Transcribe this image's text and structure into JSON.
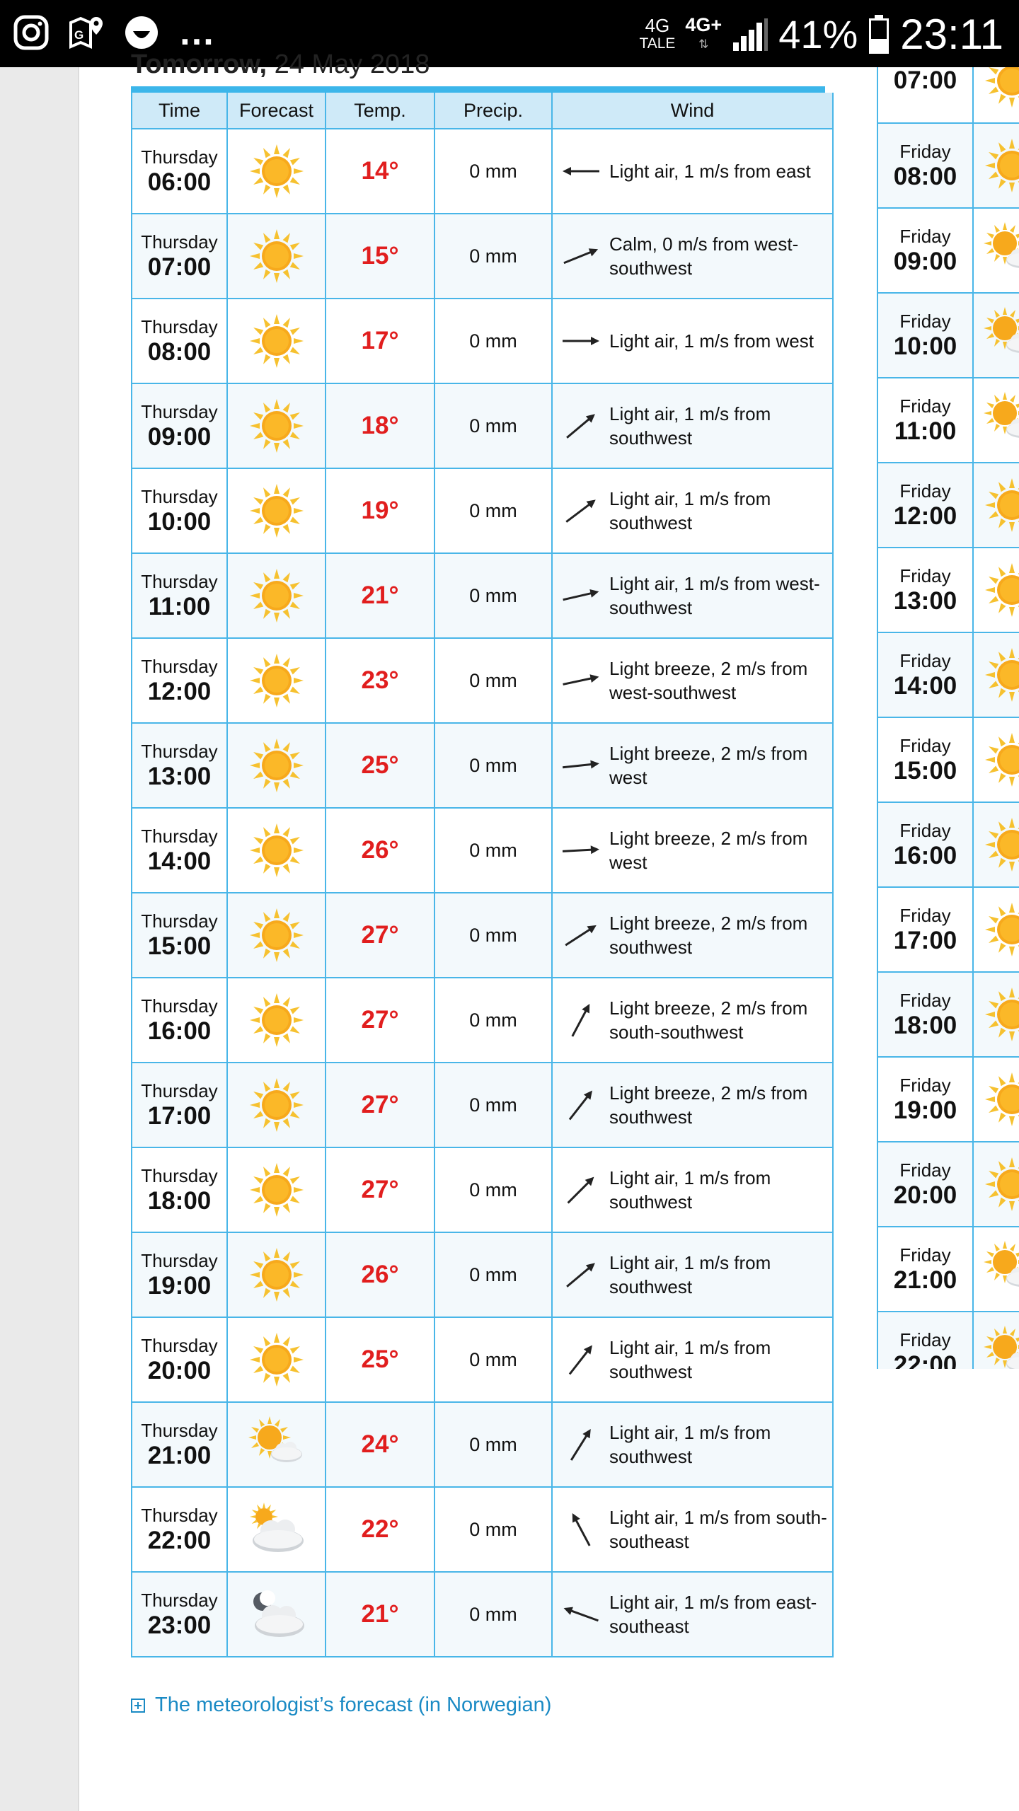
{
  "status_bar": {
    "network_1": "4G",
    "network_1_sub": "TALE",
    "network_2": "4G+",
    "battery": "41%",
    "time": "23:11"
  },
  "heading": {
    "bold": "Tomorrow,",
    "date": "24 May 2018"
  },
  "columns": {
    "time": "Time",
    "forecast": "Forecast",
    "temp": "Temp.",
    "precip": "Precip.",
    "wind": "Wind"
  },
  "rows": [
    {
      "day": "Thursday",
      "hour": "06:00",
      "icon": "sun-icon",
      "temp": "14°",
      "precip": "0 mm",
      "wind_deg": 180,
      "wind": "Light air, 1 m/s from east"
    },
    {
      "day": "Thursday",
      "hour": "07:00",
      "icon": "sun-icon",
      "temp": "15°",
      "precip": "0 mm",
      "wind_deg": -22,
      "wind": "Calm, 0 m/s from west-southwest"
    },
    {
      "day": "Thursday",
      "hour": "08:00",
      "icon": "sun-icon",
      "temp": "17°",
      "precip": "0 mm",
      "wind_deg": 0,
      "wind": "Light air, 1 m/s from west"
    },
    {
      "day": "Thursday",
      "hour": "09:00",
      "icon": "sun-icon",
      "temp": "18°",
      "precip": "0 mm",
      "wind_deg": -40,
      "wind": "Light air, 1 m/s from southwest"
    },
    {
      "day": "Thursday",
      "hour": "10:00",
      "icon": "sun-icon",
      "temp": "19°",
      "precip": "0 mm",
      "wind_deg": -37,
      "wind": "Light air, 1 m/s from southwest"
    },
    {
      "day": "Thursday",
      "hour": "11:00",
      "icon": "sun-icon",
      "temp": "21°",
      "precip": "0 mm",
      "wind_deg": -13,
      "wind": "Light air, 1 m/s from west-southwest"
    },
    {
      "day": "Thursday",
      "hour": "12:00",
      "icon": "sun-icon",
      "temp": "23°",
      "precip": "0 mm",
      "wind_deg": -12,
      "wind": "Light breeze, 2 m/s from west-southwest"
    },
    {
      "day": "Thursday",
      "hour": "13:00",
      "icon": "sun-icon",
      "temp": "25°",
      "precip": "0 mm",
      "wind_deg": -6,
      "wind": "Light breeze, 2 m/s from west"
    },
    {
      "day": "Thursday",
      "hour": "14:00",
      "icon": "sun-icon",
      "temp": "26°",
      "precip": "0 mm",
      "wind_deg": -3,
      "wind": "Light breeze, 2 m/s from west"
    },
    {
      "day": "Thursday",
      "hour": "15:00",
      "icon": "sun-icon",
      "temp": "27°",
      "precip": "0 mm",
      "wind_deg": -33,
      "wind": "Light breeze, 2 m/s from southwest"
    },
    {
      "day": "Thursday",
      "hour": "16:00",
      "icon": "sun-icon",
      "temp": "27°",
      "precip": "0 mm",
      "wind_deg": -62,
      "wind": "Light breeze, 2 m/s from south-southwest"
    },
    {
      "day": "Thursday",
      "hour": "17:00",
      "icon": "sun-icon",
      "temp": "27°",
      "precip": "0 mm",
      "wind_deg": -52,
      "wind": "Light breeze, 2 m/s from southwest"
    },
    {
      "day": "Thursday",
      "hour": "18:00",
      "icon": "sun-icon",
      "temp": "27°",
      "precip": "0 mm",
      "wind_deg": -45,
      "wind": "Light air, 1 m/s from southwest"
    },
    {
      "day": "Thursday",
      "hour": "19:00",
      "icon": "sun-icon",
      "temp": "26°",
      "precip": "0 mm",
      "wind_deg": -40,
      "wind": "Light air, 1 m/s from southwest"
    },
    {
      "day": "Thursday",
      "hour": "20:00",
      "icon": "sun-icon",
      "temp": "25°",
      "precip": "0 mm",
      "wind_deg": -52,
      "wind": "Light air, 1 m/s from southwest"
    },
    {
      "day": "Thursday",
      "hour": "21:00",
      "icon": "sun-cloud-icon",
      "temp": "24°",
      "precip": "0 mm",
      "wind_deg": -58,
      "wind": "Light air, 1 m/s from southwest"
    },
    {
      "day": "Thursday",
      "hour": "22:00",
      "icon": "cloud-sun-icon",
      "temp": "22°",
      "precip": "0 mm",
      "wind_deg": -118,
      "wind": "Light air, 1 m/s from south-southeast"
    },
    {
      "day": "Thursday",
      "hour": "23:00",
      "icon": "moon-cloud-icon",
      "temp": "21°",
      "precip": "0 mm",
      "wind_deg": -160,
      "wind": "Light air, 1 m/s from east-southeast"
    }
  ],
  "right_rows": [
    {
      "day": "",
      "hour": "07:00",
      "icon": "sun-icon"
    },
    {
      "day": "Friday",
      "hour": "08:00",
      "icon": "sun-icon"
    },
    {
      "day": "Friday",
      "hour": "09:00",
      "icon": "sun-cloud-icon"
    },
    {
      "day": "Friday",
      "hour": "10:00",
      "icon": "sun-cloud-icon"
    },
    {
      "day": "Friday",
      "hour": "11:00",
      "icon": "sun-cloud-icon"
    },
    {
      "day": "Friday",
      "hour": "12:00",
      "icon": "sun-icon"
    },
    {
      "day": "Friday",
      "hour": "13:00",
      "icon": "sun-icon"
    },
    {
      "day": "Friday",
      "hour": "14:00",
      "icon": "sun-icon"
    },
    {
      "day": "Friday",
      "hour": "15:00",
      "icon": "sun-icon"
    },
    {
      "day": "Friday",
      "hour": "16:00",
      "icon": "sun-icon"
    },
    {
      "day": "Friday",
      "hour": "17:00",
      "icon": "sun-icon"
    },
    {
      "day": "Friday",
      "hour": "18:00",
      "icon": "sun-icon"
    },
    {
      "day": "Friday",
      "hour": "19:00",
      "icon": "sun-icon"
    },
    {
      "day": "Friday",
      "hour": "20:00",
      "icon": "sun-icon"
    },
    {
      "day": "Friday",
      "hour": "21:00",
      "icon": "sun-cloud-icon"
    },
    {
      "day": "Friday",
      "hour": "22:00",
      "icon": "sun-cloud-icon"
    }
  ],
  "meteorologist_link": "The meteorologist’s forecast (in Norwegian)"
}
